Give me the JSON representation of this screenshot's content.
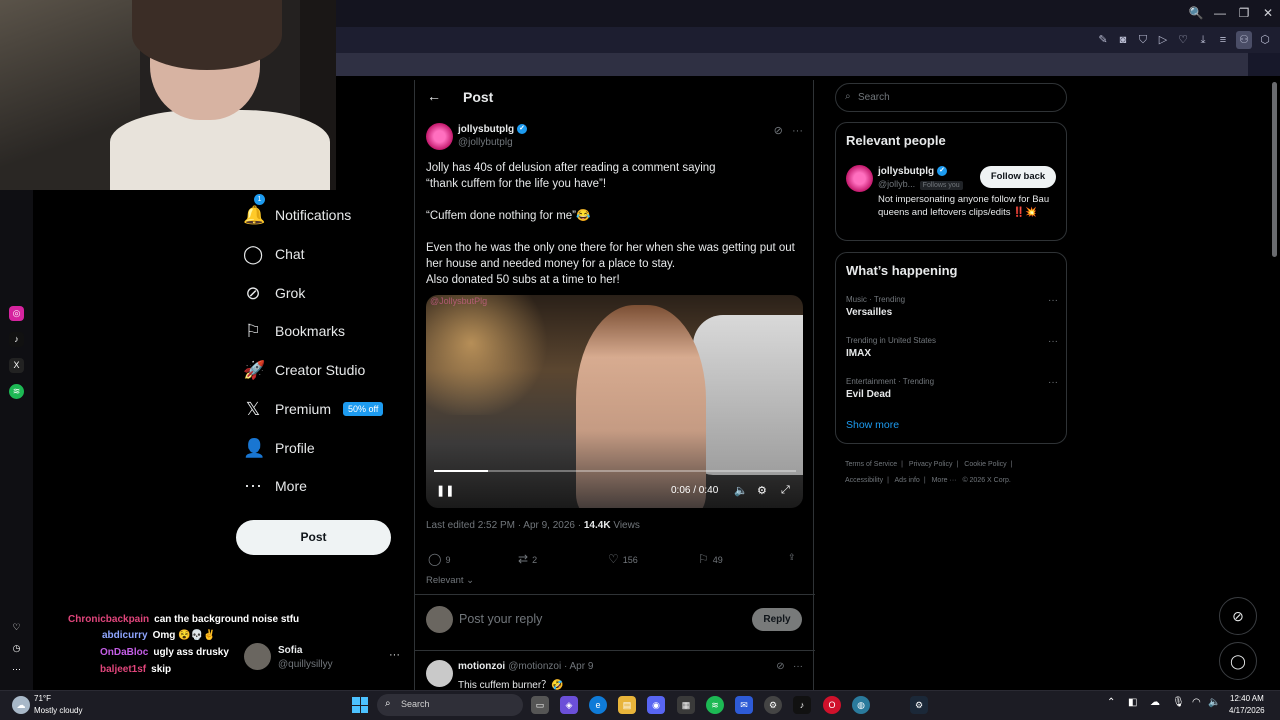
{
  "browser": {
    "window_controls": [
      "🔍",
      "—",
      "❐",
      "✕"
    ],
    "toolbar_icons": [
      "✎",
      "◙",
      "⛉",
      "▷",
      "♡",
      "⤓",
      "≡",
      "⚇",
      "⬡"
    ]
  },
  "nav": {
    "items": [
      {
        "label": "Notifications",
        "icon": "bell-icon",
        "glyph": "🔔",
        "badge": "1"
      },
      {
        "label": "Chat",
        "icon": "chat-icon",
        "glyph": "◯"
      },
      {
        "label": "Grok",
        "icon": "grok-icon",
        "glyph": "⊘"
      },
      {
        "label": "Bookmarks",
        "icon": "bookmark-icon",
        "glyph": "⚐"
      },
      {
        "label": "Creator Studio",
        "icon": "rocket-icon",
        "glyph": "🚀"
      },
      {
        "label": "Premium",
        "icon": "x-logo-icon",
        "glyph": "𝕏",
        "pill": "50% off"
      },
      {
        "label": "Profile",
        "icon": "person-icon",
        "glyph": "👤"
      },
      {
        "label": "More",
        "icon": "more-circle-icon",
        "glyph": "⋯"
      }
    ],
    "post_button": "Post"
  },
  "account": {
    "name": "Sofia",
    "handle": "@quillysillyy",
    "more": "···"
  },
  "chat_overlay": [
    {
      "user": "Chronicbackpain",
      "msg": "can the background noise stfu",
      "color": "#e0457b"
    },
    {
      "user": "abdicurry",
      "msg": "Omg 😵💀✌",
      "color": "#8fa6ff"
    },
    {
      "user": "OnDaBloc",
      "msg": "ugly ass drusky",
      "color": "#c45ee6"
    },
    {
      "user": "baljeet1sf",
      "msg": "skip",
      "color": "#e0457b"
    }
  ],
  "post": {
    "header_title": "Post",
    "author_name": "jollysbutplg",
    "author_handle": "@jollybutplg",
    "text_lines": [
      "Jolly has 40s of delusion after reading a comment saying",
      "“thank cuffem for the life you have”!",
      "“Cuffem done nothing for me”😂",
      "Even tho he was the only one there for her when she was getting put out",
      "her house and needed money for a place to stay.",
      "Also donated 50 subs at a time to her!"
    ],
    "video": {
      "watermark": "@JollysbutPlg",
      "time": "0:06 / 0:40",
      "progress": 0.15
    },
    "meta_prefix": "Last edited 2:52 PM · Apr 9, 2026 · ",
    "views_count": "14.4K",
    "views_label": " Views",
    "stats": {
      "replies": "9",
      "reposts": "2",
      "likes": "156",
      "bookmarks": "49"
    },
    "sort_label": "Relevant"
  },
  "reply": {
    "placeholder": "Post your reply",
    "button": "Reply"
  },
  "comment": {
    "name": "motionzoi",
    "handle": "@motionzoi · Apr 9",
    "text": "This cuffem burner？🤣"
  },
  "sidebar": {
    "search_placeholder": "Search",
    "relevant_title": "Relevant people",
    "relevant_person": {
      "name": "jollysbutplg",
      "handle": "@jollyb...",
      "follows_you": "Follows you",
      "button": "Follow back",
      "bio": "Not impersonating anyone follow for Bau queens and leftovers clips/edits ‼️💥"
    },
    "happening_title": "What’s happening",
    "trends": [
      {
        "category": "Music · Trending",
        "name": "Versailles"
      },
      {
        "category": "Trending in United States",
        "name": "IMAX"
      },
      {
        "category": "Entertainment · Trending",
        "name": "Evil Dead"
      }
    ],
    "show_more": "Show more",
    "footer": [
      "Terms of Service",
      "|",
      "Privacy Policy",
      "|",
      "Cookie Policy",
      "|",
      "Accessibility",
      "|",
      "Ads info",
      "|",
      "More ···",
      "© 2026 X Corp."
    ]
  },
  "taskbar": {
    "weather_temp": "71°F",
    "weather_desc": "Mostly cloudy",
    "search_placeholder": "Search",
    "time": "12:40 AM",
    "date": "4/17/2026"
  },
  "colors": {
    "accent": "#1d9bf0",
    "background": "#000000",
    "border": "#2f3336"
  }
}
